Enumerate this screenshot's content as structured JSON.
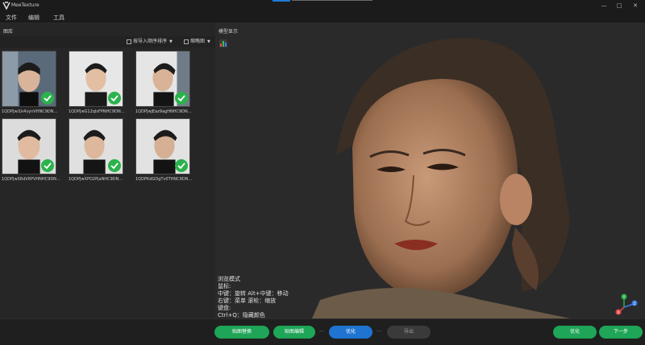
{
  "app": {
    "title": "MeeTexture"
  },
  "window_controls": {
    "minimize": "—",
    "maximize": "□",
    "close": "✕"
  },
  "menu": [
    "文件",
    "编辑",
    "工具"
  ],
  "gallery": {
    "header": "图库",
    "sort_label": "按导入顺序排序",
    "view_label": "缩略图",
    "items": [
      {
        "label": "1QDPJwi1k4vynVHNC9DN…",
        "checked": true
      },
      {
        "label": "1QDPJwG12qIsFPNHC9DN…",
        "checked": true
      },
      {
        "label": "1QDPJwjEaz9agHNHC9DN…",
        "checked": true
      },
      {
        "label": "1QDPJwSRdV6PVHNHC9DN…",
        "checked": true
      },
      {
        "label": "1QDPJwXPO2PjaNHC9DN…",
        "checked": true
      },
      {
        "label": "1QDPKdGOgTv0THNC9DN…",
        "checked": true
      }
    ]
  },
  "model_view": {
    "header": "模型显示",
    "help_lines": [
      "浏览模式",
      "鼠标:",
      "中键：旋转  Alt+中键：移动",
      "右键：菜单  滚轮：缩放",
      "键盘:",
      "Ctrl+Q：隐藏颜色"
    ],
    "axis": {
      "x": "X",
      "y": "Y",
      "z": "Z"
    }
  },
  "bottom_actions": {
    "texture_replace": "贴图替换",
    "texture_edit": "贴图编辑",
    "optimize": "优化",
    "export": "导出",
    "optimize2": "优化",
    "next": "下一步",
    "separator": "···"
  },
  "colors": {
    "accent_green": "#1fa557",
    "accent_blue": "#1f74d1",
    "check_green": "#2bb24c"
  }
}
